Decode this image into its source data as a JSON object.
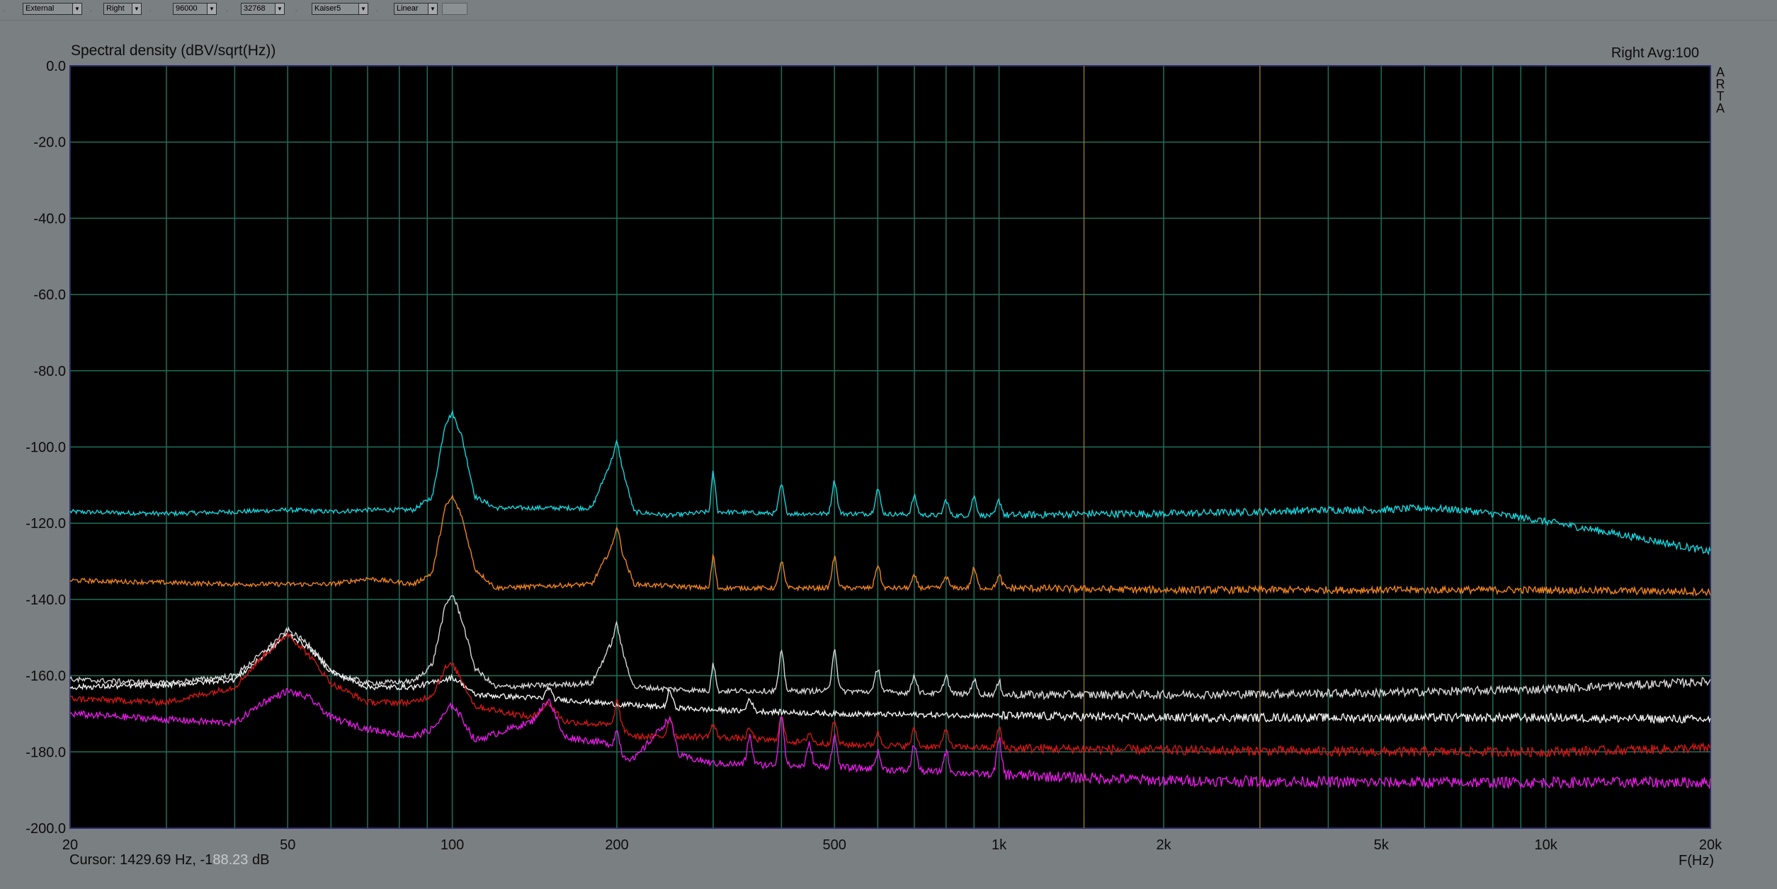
{
  "toolbar": {
    "input_source": "External",
    "channel": "Right",
    "sample_rate": "96000",
    "fft_size": "32768",
    "window": "Kaiser5",
    "averaging": "Linear"
  },
  "plot": {
    "title": "Spectral density (dBV/sqrt(Hz))",
    "channel_info": "Right  Avg:100",
    "logo_letters": [
      "A",
      "R",
      "T",
      "A"
    ],
    "x_axis_label": "F(Hz)",
    "cursor_prefix": "Cursor: 1429.69 Hz, -1",
    "cursor_masked": "88.23",
    "cursor_unit": " dB"
  },
  "colors": {
    "background": "#7a7f82",
    "plot_bg": "#000000",
    "grid": "#1f6f5a",
    "grid_3k": "#8f6f2a"
  },
  "chart_data": {
    "type": "line",
    "x_scale": "log",
    "xlim": [
      20,
      20000
    ],
    "ylim": [
      -200,
      0
    ],
    "grid": true,
    "y_ticks": [
      "0.0",
      "-20.0",
      "-40.0",
      "-60.0",
      "-80.0",
      "-100.0",
      "-120.0",
      "-140.0",
      "-160.0",
      "-180.0",
      "-200.0"
    ],
    "x_ticks": [
      {
        "value": 20,
        "label": "20"
      },
      {
        "value": 50,
        "label": "50"
      },
      {
        "value": 100,
        "label": "100"
      },
      {
        "value": 200,
        "label": "200"
      },
      {
        "value": 500,
        "label": "500"
      },
      {
        "value": 1000,
        "label": "1k"
      },
      {
        "value": 2000,
        "label": "2k"
      },
      {
        "value": 5000,
        "label": "5k"
      },
      {
        "value": 10000,
        "label": "10k"
      },
      {
        "value": 20000,
        "label": "20k"
      }
    ],
    "series": [
      {
        "color": "#19d4dc",
        "noise": 0.6,
        "points": [
          [
            20,
            -117
          ],
          [
            30,
            -117.5
          ],
          [
            40,
            -117
          ],
          [
            50,
            -116.5
          ],
          [
            60,
            -117
          ],
          [
            70,
            -116.5
          ],
          [
            85,
            -116.5
          ],
          [
            92,
            -113
          ],
          [
            97,
            -94
          ],
          [
            100,
            -91
          ],
          [
            104,
            -97
          ],
          [
            110,
            -113
          ],
          [
            120,
            -116
          ],
          [
            150,
            -116
          ],
          [
            180,
            -116
          ],
          [
            196,
            -103
          ],
          [
            200,
            -98.5
          ],
          [
            205,
            -106
          ],
          [
            215,
            -117
          ],
          [
            250,
            -118
          ],
          [
            295,
            -117
          ],
          [
            300,
            -106
          ],
          [
            306,
            -117
          ],
          [
            400,
            -117.5
          ],
          [
            500,
            -117.5
          ],
          [
            600,
            -117.5
          ],
          [
            800,
            -118
          ],
          [
            1000,
            -118
          ],
          [
            1500,
            -117.5
          ],
          [
            2000,
            -117.5
          ],
          [
            3000,
            -117
          ],
          [
            4000,
            -116.5
          ],
          [
            5000,
            -116.5
          ],
          [
            6000,
            -116
          ],
          [
            7000,
            -116.5
          ],
          [
            8000,
            -117.5
          ],
          [
            9000,
            -118.5
          ],
          [
            10000,
            -119.5
          ],
          [
            12000,
            -121.5
          ],
          [
            15000,
            -124
          ],
          [
            20000,
            -127.5
          ]
        ],
        "peaks": [
          [
            400,
            -110
          ],
          [
            500,
            -109
          ],
          [
            600,
            -111
          ],
          [
            700,
            -113
          ],
          [
            800,
            -114
          ],
          [
            900,
            -113
          ],
          [
            1000,
            -114
          ]
        ]
      },
      {
        "color": "#ee8420",
        "noise": 0.6,
        "points": [
          [
            20,
            -135
          ],
          [
            40,
            -136
          ],
          [
            60,
            -136
          ],
          [
            70,
            -134.5
          ],
          [
            85,
            -136
          ],
          [
            92,
            -133
          ],
          [
            97,
            -116
          ],
          [
            100,
            -113
          ],
          [
            104,
            -118
          ],
          [
            110,
            -132
          ],
          [
            120,
            -137
          ],
          [
            180,
            -136
          ],
          [
            196,
            -126
          ],
          [
            200,
            -120.5
          ],
          [
            205,
            -128
          ],
          [
            215,
            -136
          ],
          [
            295,
            -137
          ],
          [
            300,
            -128
          ],
          [
            306,
            -137
          ],
          [
            500,
            -137
          ],
          [
            1000,
            -137
          ],
          [
            2000,
            -137.5
          ],
          [
            5000,
            -137.5
          ],
          [
            10000,
            -137.5
          ],
          [
            20000,
            -138
          ]
        ],
        "peaks": [
          [
            400,
            -130
          ],
          [
            500,
            -129
          ],
          [
            600,
            -131
          ],
          [
            700,
            -134
          ],
          [
            800,
            -134
          ],
          [
            900,
            -132
          ],
          [
            1000,
            -134
          ]
        ]
      },
      {
        "color": "#d6d6d6",
        "noise": 0.7,
        "points": [
          [
            20,
            -161
          ],
          [
            30,
            -162
          ],
          [
            40,
            -160
          ],
          [
            45,
            -154
          ],
          [
            50,
            -148
          ],
          [
            55,
            -152
          ],
          [
            60,
            -159
          ],
          [
            70,
            -162
          ],
          [
            85,
            -161.5
          ],
          [
            92,
            -157
          ],
          [
            97,
            -142
          ],
          [
            100,
            -138.5
          ],
          [
            104,
            -145
          ],
          [
            110,
            -158
          ],
          [
            120,
            -163
          ],
          [
            180,
            -162
          ],
          [
            196,
            -151
          ],
          [
            200,
            -146
          ],
          [
            205,
            -154
          ],
          [
            215,
            -163
          ],
          [
            295,
            -164
          ],
          [
            300,
            -156
          ],
          [
            306,
            -164
          ],
          [
            400,
            -164
          ],
          [
            500,
            -164
          ],
          [
            1000,
            -165
          ],
          [
            2000,
            -165
          ],
          [
            5000,
            -164.5
          ],
          [
            10000,
            -163.5
          ],
          [
            20000,
            -161.5
          ]
        ],
        "peaks": [
          [
            400,
            -154
          ],
          [
            500,
            -153
          ],
          [
            600,
            -158
          ],
          [
            700,
            -160
          ],
          [
            800,
            -160
          ],
          [
            900,
            -161
          ],
          [
            1000,
            -162
          ]
        ]
      },
      {
        "color": "#f2f2f2",
        "noise": 0.7,
        "points": [
          [
            20,
            -163
          ],
          [
            30,
            -162.5
          ],
          [
            40,
            -161
          ],
          [
            45,
            -155
          ],
          [
            50,
            -149
          ],
          [
            55,
            -153
          ],
          [
            60,
            -159
          ],
          [
            70,
            -163
          ],
          [
            85,
            -163
          ],
          [
            97,
            -161
          ],
          [
            100,
            -160.5
          ],
          [
            104,
            -162
          ],
          [
            110,
            -165
          ],
          [
            150,
            -166
          ],
          [
            200,
            -167.5
          ],
          [
            300,
            -169
          ],
          [
            500,
            -170
          ],
          [
            1000,
            -170.5
          ],
          [
            2000,
            -171
          ],
          [
            5000,
            -171
          ],
          [
            10000,
            -171
          ],
          [
            20000,
            -171.5
          ]
        ],
        "peaks": [
          [
            150,
            -163
          ],
          [
            250,
            -164
          ],
          [
            350,
            -166
          ]
        ]
      },
      {
        "color": "#d01818",
        "noise": 0.8,
        "points": [
          [
            20,
            -166
          ],
          [
            30,
            -167
          ],
          [
            40,
            -163
          ],
          [
            45,
            -155
          ],
          [
            50,
            -149
          ],
          [
            55,
            -155
          ],
          [
            60,
            -162
          ],
          [
            70,
            -167
          ],
          [
            85,
            -167
          ],
          [
            92,
            -165
          ],
          [
            97,
            -158
          ],
          [
            100,
            -157
          ],
          [
            104,
            -161
          ],
          [
            110,
            -168
          ],
          [
            140,
            -171
          ],
          [
            150,
            -167
          ],
          [
            160,
            -172
          ],
          [
            196,
            -173
          ],
          [
            200,
            -166
          ],
          [
            205,
            -174
          ],
          [
            215,
            -176
          ],
          [
            300,
            -176
          ],
          [
            500,
            -178
          ],
          [
            1000,
            -179
          ],
          [
            2000,
            -179.5
          ],
          [
            5000,
            -180
          ],
          [
            10000,
            -180
          ],
          [
            20000,
            -179
          ]
        ],
        "peaks": [
          [
            250,
            -171
          ],
          [
            300,
            -173
          ],
          [
            350,
            -174
          ],
          [
            400,
            -171
          ],
          [
            450,
            -175
          ],
          [
            500,
            -172
          ],
          [
            600,
            -175
          ],
          [
            700,
            -174
          ],
          [
            800,
            -174
          ],
          [
            1000,
            -174
          ]
        ]
      },
      {
        "color": "#e21de2",
        "noise": 0.9,
        "points": [
          [
            20,
            -170
          ],
          [
            30,
            -171.5
          ],
          [
            40,
            -172.5
          ],
          [
            45,
            -167
          ],
          [
            50,
            -164
          ],
          [
            55,
            -166
          ],
          [
            60,
            -171
          ],
          [
            70,
            -174
          ],
          [
            85,
            -176
          ],
          [
            92,
            -174
          ],
          [
            97,
            -170
          ],
          [
            100,
            -167.5
          ],
          [
            104,
            -171
          ],
          [
            110,
            -177
          ],
          [
            140,
            -172
          ],
          [
            150,
            -166
          ],
          [
            160,
            -176
          ],
          [
            196,
            -178
          ],
          [
            200,
            -174
          ],
          [
            205,
            -181
          ],
          [
            215,
            -182
          ],
          [
            250,
            -171
          ],
          [
            260,
            -181
          ],
          [
            300,
            -183
          ],
          [
            500,
            -184
          ],
          [
            1000,
            -186
          ],
          [
            2000,
            -187.5
          ],
          [
            5000,
            -188
          ],
          [
            10000,
            -188
          ],
          [
            20000,
            -188
          ]
        ],
        "peaks": [
          [
            350,
            -176
          ],
          [
            400,
            -170
          ],
          [
            450,
            -178
          ],
          [
            500,
            -176
          ],
          [
            600,
            -180
          ],
          [
            700,
            -178
          ],
          [
            800,
            -180
          ],
          [
            1000,
            -177
          ]
        ]
      }
    ]
  }
}
